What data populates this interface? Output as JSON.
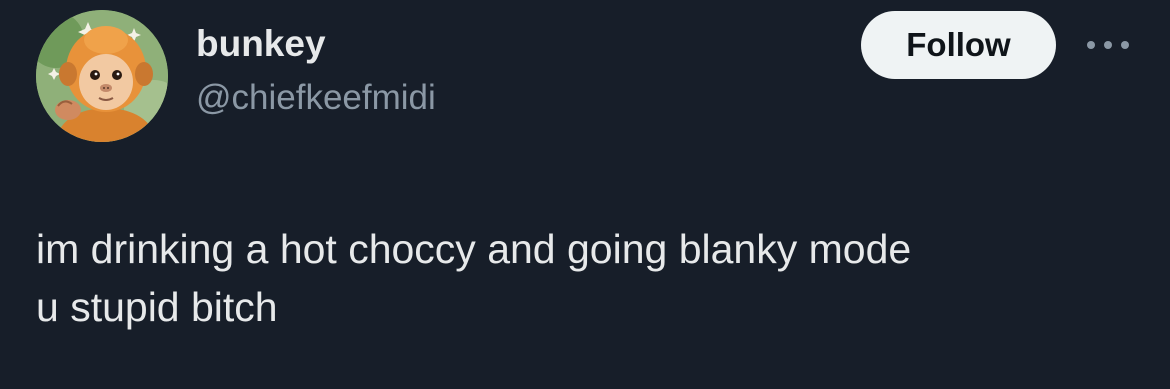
{
  "author": {
    "display_name": "bunkey",
    "handle": "@chiefkeefmidi",
    "avatar_icon": "baby-monkey-avatar"
  },
  "actions": {
    "follow_label": "Follow",
    "more_icon": "more-horizontal-icon"
  },
  "tweet": {
    "text": "im drinking a hot choccy and going blanky mode\nu stupid bitch"
  },
  "colors": {
    "background": "#171e29",
    "text_primary": "#e7e9ea",
    "text_secondary": "#8b98a5",
    "follow_bg": "#eff3f4",
    "follow_text": "#0f1419"
  }
}
